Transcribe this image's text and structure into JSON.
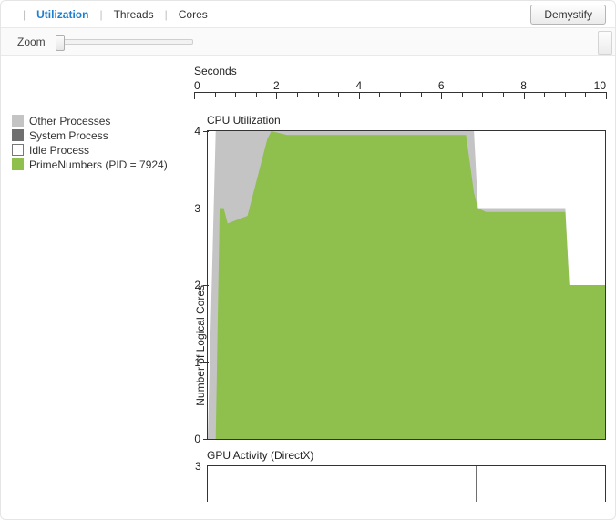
{
  "tabs": {
    "utilization": "Utilization",
    "threads": "Threads",
    "cores": "Cores"
  },
  "buttons": {
    "demystify": "Demystify"
  },
  "zoom": {
    "label": "Zoom"
  },
  "xaxis": {
    "label": "Seconds",
    "ticks": [
      "0",
      "2",
      "4",
      "6",
      "8",
      "10"
    ]
  },
  "legend": {
    "items": [
      {
        "label": "Other Processes",
        "color": "#c4c4c4"
      },
      {
        "label": "System Process",
        "color": "#6f6f6f"
      },
      {
        "label": "Idle Process",
        "color": "#ffffff"
      },
      {
        "label": "PrimeNumbers (PID = 7924)",
        "color": "#8fbf4d"
      }
    ]
  },
  "cpu": {
    "title": "CPU Utilization",
    "ylabel": "Number of Logical Cores",
    "ymax": 4,
    "yticks": [
      "0",
      "1",
      "2",
      "3",
      "4"
    ]
  },
  "gpu": {
    "title": "GPU Activity (DirectX)",
    "ytick": "3"
  },
  "chart_data": {
    "type": "area",
    "title": "CPU Utilization",
    "xlabel": "Seconds",
    "ylabel": "Number of Logical Cores",
    "xlim": [
      0,
      10
    ],
    "ylim": [
      0,
      4
    ],
    "series": [
      {
        "name": "PrimeNumbers (PID = 7924)",
        "color": "#8fbf4d",
        "x": [
          0.0,
          0.2,
          0.3,
          0.4,
          0.5,
          1.0,
          1.5,
          1.6,
          2.0,
          3.0,
          4.0,
          5.0,
          6.0,
          6.5,
          6.7,
          6.8,
          7.0,
          8.0,
          9.0,
          9.1,
          10.0
        ],
        "values": [
          0.0,
          0.0,
          3.0,
          3.0,
          2.8,
          2.9,
          3.9,
          4.0,
          3.95,
          3.95,
          3.95,
          3.95,
          3.95,
          3.95,
          3.2,
          3.0,
          2.95,
          2.95,
          2.95,
          2.0,
          2.0
        ]
      },
      {
        "name": "Other Processes",
        "color": "#c4c4c4",
        "note": "approximate upper envelope; stacked above PrimeNumbers — fills to ~4 cores between x≈0.3 and x≈6.7, then drops to ~3 until x≈9.1, then ~2",
        "x": [
          0.0,
          0.2,
          0.3,
          1.5,
          6.5,
          6.7,
          6.8,
          9.0,
          9.1,
          10.0
        ],
        "values": [
          0.0,
          4.0,
          4.0,
          4.0,
          4.0,
          4.0,
          3.0,
          3.0,
          2.0,
          2.0
        ]
      },
      {
        "name": "System Process",
        "color": "#6f6f6f",
        "note": "negligible / not visibly distinguishable at this scale",
        "x": [
          0,
          10
        ],
        "values": [
          0,
          0
        ]
      },
      {
        "name": "Idle Process",
        "color": "#ffffff",
        "note": "remaining white area above the stacked colored regions up to y=4"
      }
    ],
    "gpu": {
      "type": "line",
      "title": "GPU Activity (DirectX)",
      "ylim": [
        0,
        3
      ],
      "note": "essentially zero with two brief spikes",
      "spikes_x": [
        0.05,
        6.75
      ]
    }
  }
}
